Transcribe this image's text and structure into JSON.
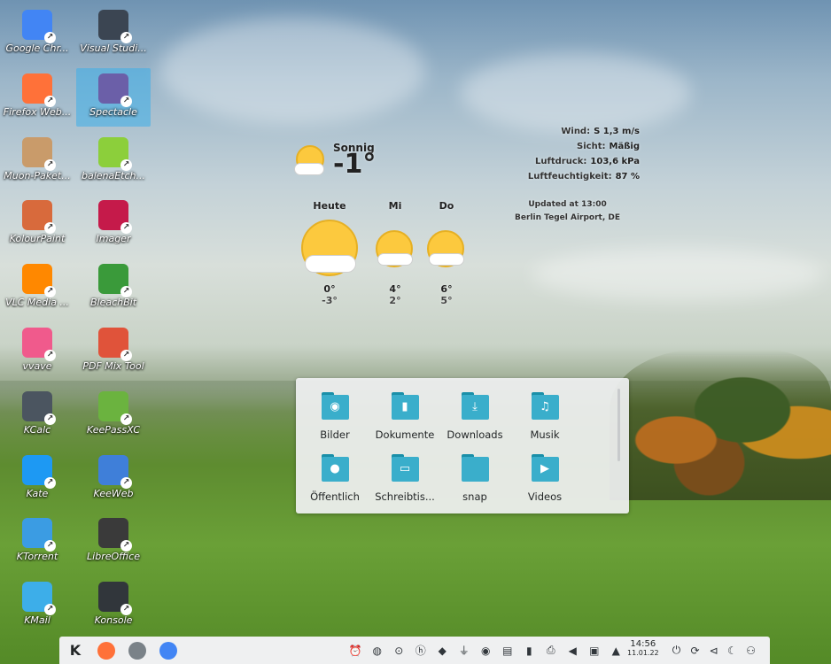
{
  "desktop_icons": [
    {
      "label": "Google Chr...",
      "icon": "chrome-icon",
      "color": "#4285f4"
    },
    {
      "label": "Visual Studi...",
      "icon": "vscode-icon",
      "color": "#3b4552"
    },
    {
      "label": "Firefox Web...",
      "icon": "firefox-icon",
      "color": "#ff7139"
    },
    {
      "label": "Spectacle",
      "icon": "spectacle-icon",
      "color": "#6b5fa8"
    },
    {
      "label": "Muon-Paket...",
      "icon": "package-icon",
      "color": "#c99b6a"
    },
    {
      "label": "balenaEtch...",
      "icon": "balena-etcher-icon",
      "color": "#8ccf3b"
    },
    {
      "label": "KolourPaint",
      "icon": "paint-icon",
      "color": "#d86a3c"
    },
    {
      "label": "Imager",
      "icon": "raspberry-icon",
      "color": "#c51a4a"
    },
    {
      "label": "VLC Media ...",
      "icon": "vlc-icon",
      "color": "#ff8800"
    },
    {
      "label": "BleachBit",
      "icon": "recycle-icon",
      "color": "#3a9a3a"
    },
    {
      "label": "vvave",
      "icon": "vvave-icon",
      "color": "#f05a8c"
    },
    {
      "label": "PDF Mix Tool",
      "icon": "pdf-tool-icon",
      "color": "#e0533a"
    },
    {
      "label": "KCalc",
      "icon": "calculator-icon",
      "color": "#4b5560"
    },
    {
      "label": "KeePassXC",
      "icon": "keepass-icon",
      "color": "#6bb33f"
    },
    {
      "label": "Kate",
      "icon": "kate-icon",
      "color": "#1d99f3"
    },
    {
      "label": "KeeWeb",
      "icon": "keeweb-icon",
      "color": "#3f7fd9"
    },
    {
      "label": "KTorrent",
      "icon": "ktorrent-icon",
      "color": "#3b9ce3"
    },
    {
      "label": "LibreOffice",
      "icon": "libreoffice-icon",
      "color": "#3a3a3a"
    },
    {
      "label": "KMail",
      "icon": "mail-icon",
      "color": "#3daee9"
    },
    {
      "label": "Konsole",
      "icon": "terminal-icon",
      "color": "#31363b"
    }
  ],
  "weather": {
    "condition": "Sonnig",
    "temperature": "-1°",
    "details": [
      {
        "label": "Wind:",
        "value": "S 1,3 m/s"
      },
      {
        "label": "Sicht:",
        "value": "Mäßig"
      },
      {
        "label": "Luftdruck:",
        "value": "103,6 kPa"
      },
      {
        "label": "Luftfeuchtigkeit:",
        "value": "87 %"
      }
    ],
    "updated": "Updated at 13:00",
    "station": "Berlin Tegel Airport, DE",
    "forecast": [
      {
        "day": "Heute",
        "high": "0°",
        "low": "-3°"
      },
      {
        "day": "Mi",
        "high": "4°",
        "low": "2°"
      },
      {
        "day": "Do",
        "high": "6°",
        "low": "5°"
      }
    ]
  },
  "folders": [
    {
      "label": "Bilder",
      "icon": "camera-icon",
      "glyph": "◉"
    },
    {
      "label": "Dokumente",
      "icon": "document-icon",
      "glyph": "▮"
    },
    {
      "label": "Downloads",
      "icon": "download-icon",
      "glyph": "⤓"
    },
    {
      "label": "Musik",
      "icon": "music-icon",
      "glyph": "♫"
    },
    {
      "label": "Öffentlich",
      "icon": "person-icon",
      "glyph": "●"
    },
    {
      "label": "Schreibtis...",
      "icon": "desktop-icon",
      "glyph": "▭"
    },
    {
      "label": "snap",
      "icon": "folder-icon",
      "glyph": ""
    },
    {
      "label": "Videos",
      "icon": "video-icon",
      "glyph": "▶"
    }
  ],
  "taskbar": {
    "launcher_icon": "kde-menu-icon",
    "apps": [
      {
        "icon": "firefox-icon",
        "color": "#ff7139"
      },
      {
        "icon": "file-manager-icon",
        "color": "#7a8288"
      },
      {
        "icon": "chrome-icon",
        "color": "#4285f4"
      }
    ],
    "tray": [
      {
        "icon": "alarm-icon",
        "glyph": "⏰"
      },
      {
        "icon": "chrome-tray-icon",
        "glyph": "◍"
      },
      {
        "icon": "keepassxc-tray-icon",
        "glyph": "⊙"
      },
      {
        "icon": "hp-icon",
        "glyph": "ⓗ"
      },
      {
        "icon": "plasma-browser-icon",
        "glyph": "◆"
      },
      {
        "icon": "usb-icon",
        "glyph": "⏚"
      },
      {
        "icon": "record-icon",
        "glyph": "◉"
      },
      {
        "icon": "clipboard-icon",
        "glyph": "▤"
      },
      {
        "icon": "battery-icon",
        "glyph": "▮"
      },
      {
        "icon": "printer-icon",
        "glyph": "⎙"
      },
      {
        "icon": "volume-icon",
        "glyph": "◀"
      },
      {
        "icon": "network-icon",
        "glyph": "▣"
      },
      {
        "icon": "tray-expand-icon",
        "glyph": "▲"
      }
    ],
    "clock_time": "14:56",
    "clock_date": "11.01.22",
    "tray_right": [
      {
        "icon": "power-icon",
        "glyph": "⏻"
      },
      {
        "icon": "restart-icon",
        "glyph": "⟳"
      },
      {
        "icon": "back-icon",
        "glyph": "⊲"
      },
      {
        "icon": "night-color-icon",
        "glyph": "☾"
      },
      {
        "icon": "user-switch-icon",
        "glyph": "⚇"
      }
    ]
  }
}
